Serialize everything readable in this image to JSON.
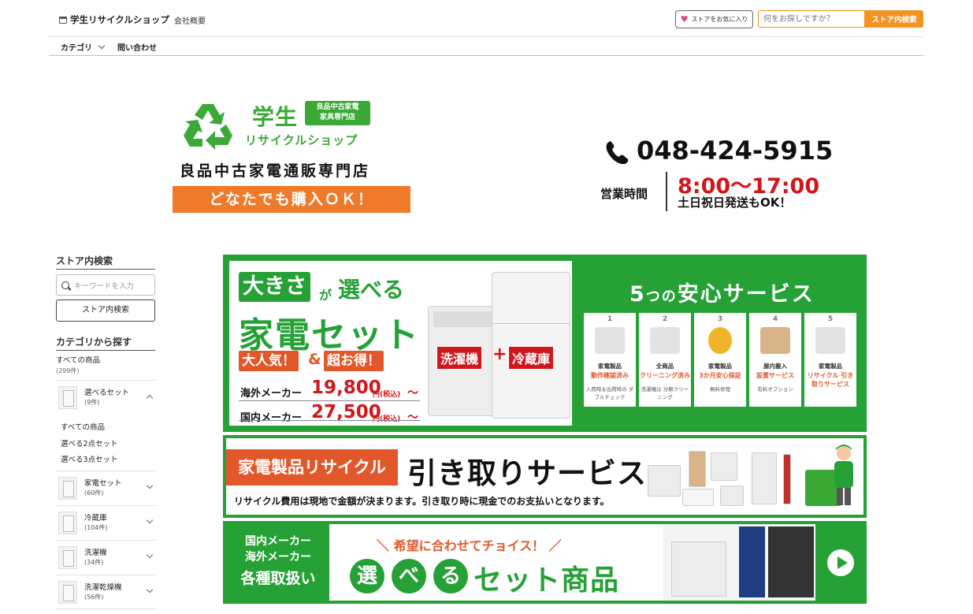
{
  "header": {
    "store_name": "学生リサイクルショップ",
    "company_link": "会社概要",
    "favorite_button": "ストアをお気に入り",
    "search_placeholder": "何をお探しですか？",
    "search_button": "ストア内検索"
  },
  "nav": {
    "category": "カテゴリ",
    "contact": "問い合わせ"
  },
  "banner_header": {
    "logo_title": "学生",
    "logo_badge_line1": "良品中古家電",
    "logo_badge_line2": "家具専門店",
    "logo_shop": "リサイクルショップ",
    "logo_sub": "良品中古家電通販専門店",
    "logo_cta": "どなたでも購入ＯＫ！",
    "phone": "048-424-5915",
    "hours_label": "営業時間",
    "hours_time": "8:00〜17:00",
    "hours_note": "土日祝日発送もOK！",
    "accent_green": "#3aa935",
    "accent_orange": "#ef7a29",
    "accent_red": "#d1161c"
  },
  "sidebar": {
    "search_heading": "ストア内検索",
    "search_placeholder": "キーワードを入力",
    "search_button": "ストア内検索",
    "category_heading": "カテゴリから探す",
    "all_items": "すべての商品",
    "all_items_count": "(299件)",
    "categories": [
      {
        "name": "選べるセット",
        "count": "(9件)",
        "expanded": true
      },
      {
        "name": "家電セット",
        "count": "(60件)",
        "expanded": false
      },
      {
        "name": "冷蔵庫",
        "count": "(104件)",
        "expanded": false
      },
      {
        "name": "洗濯機",
        "count": "(34件)",
        "expanded": false
      },
      {
        "name": "洗濯乾燥機",
        "count": "(56件)",
        "expanded": false
      }
    ],
    "subitems": [
      "すべての商品",
      "選べる2点セット",
      "選べる3点セット"
    ]
  },
  "banner1": {
    "size_word": "大きさ",
    "ga": "が",
    "eraberu": "選べる",
    "kaden_set": "家電セット",
    "tag1": "大人気！",
    "amp": "&",
    "tag2": "超お得！",
    "overseas_label": "海外メーカー",
    "overseas_price": "19,800",
    "domestic_label": "国内メーカー",
    "domestic_price": "27,500",
    "yen_tax": "円(税込)",
    "tilde": "〜",
    "washer": "洗濯機",
    "plus": "+",
    "fridge": "冷蔵庫",
    "services_title_num": "5",
    "services_title_no": "つの",
    "services_title_rest": "安心サービス",
    "services": [
      {
        "num": "1",
        "cat": "家電製品",
        "head": "動作確認済み",
        "note": "入荷時＆出荷時の ダブルチェック"
      },
      {
        "num": "2",
        "cat": "全商品",
        "head": "クリーニング済み",
        "note": "洗濯機は 分解クリーニング"
      },
      {
        "num": "3",
        "cat": "家電製品",
        "head": "3か月安心保証",
        "note": "無料修理"
      },
      {
        "num": "4",
        "cat": "屋内搬入",
        "head": "設置サービス",
        "note": "有料オプション"
      },
      {
        "num": "5",
        "cat": "家電製品",
        "head": "リサイクル 引き取りサービス",
        "note": ""
      }
    ]
  },
  "banner2": {
    "tag": "家電製品リサイクル",
    "title": "引き取りサービス",
    "note": "リサイクル費用は現地で金額が決まります。引き取り時に現金でのお支払いとなります。"
  },
  "banner3": {
    "left_line1": "国内メーカー",
    "left_line2": "海外メーカー",
    "left_line3": "各種取扱い",
    "sub": "＼ 希望に合わせてチョイス！ ／",
    "c1": "選",
    "c2": "べ",
    "c3": "る",
    "set_goods": "セット商品"
  }
}
